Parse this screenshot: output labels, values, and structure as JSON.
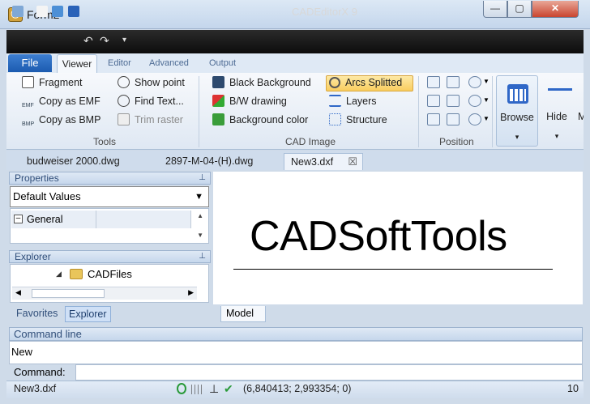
{
  "window": {
    "title": "Form2",
    "close_glyph": "✕",
    "max_glyph": "▢",
    "min_glyph": "—"
  },
  "ribbon_title": "CADEditorX 9",
  "tabs": {
    "file": "File",
    "viewer": "Viewer",
    "editor": "Editor",
    "advanced": "Advanced",
    "output": "Output"
  },
  "tools": {
    "fragment": "Fragment",
    "copy_emf": "Copy as EMF",
    "copy_bmp": "Copy as BMP",
    "show_point": "Show point",
    "find_text": "Find Text...",
    "trim_raster": "Trim raster",
    "label": "Tools",
    "emf_badge": "EMF",
    "bmp_badge": "BMP"
  },
  "cad_image": {
    "black_bg": "Black Background",
    "bw": "B/W drawing",
    "bg_color": "Background color",
    "arcs": "Arcs Splitted",
    "layers": "Layers",
    "structure": "Structure",
    "label": "CAD Image"
  },
  "position": {
    "label": "Position"
  },
  "big": {
    "browse": "Browse",
    "hide": "Hide",
    "cut": "M",
    "more": "▾"
  },
  "doc_tabs": [
    "budweiser 2000.dwg",
    "2897-M-04-(H).dwg",
    "New3.dxf"
  ],
  "close_glyph": "☒",
  "properties": {
    "title": "Properties",
    "select": "Default Values",
    "group": "General",
    "collapse_glyph": "–",
    "up": "▲",
    "down": "▼"
  },
  "explorer": {
    "title": "Explorer",
    "folder": "CADFiles",
    "left": "◀",
    "right": "▶"
  },
  "pin_glyph": "⊥",
  "bottom_tabs": {
    "favorites": "Favorites",
    "explorer": "Explorer"
  },
  "drawing": {
    "text": "CADSoftTools"
  },
  "model_tab": "Model",
  "command": {
    "title": "Command line",
    "output": "New",
    "prompt": "Command:"
  },
  "status": {
    "file": "New3.dxf",
    "coords": "(6,840413; 2,993354; 0)",
    "page": "10"
  },
  "colors": {
    "accent": "#2f67c7",
    "highlight": "#f9cd5e"
  }
}
